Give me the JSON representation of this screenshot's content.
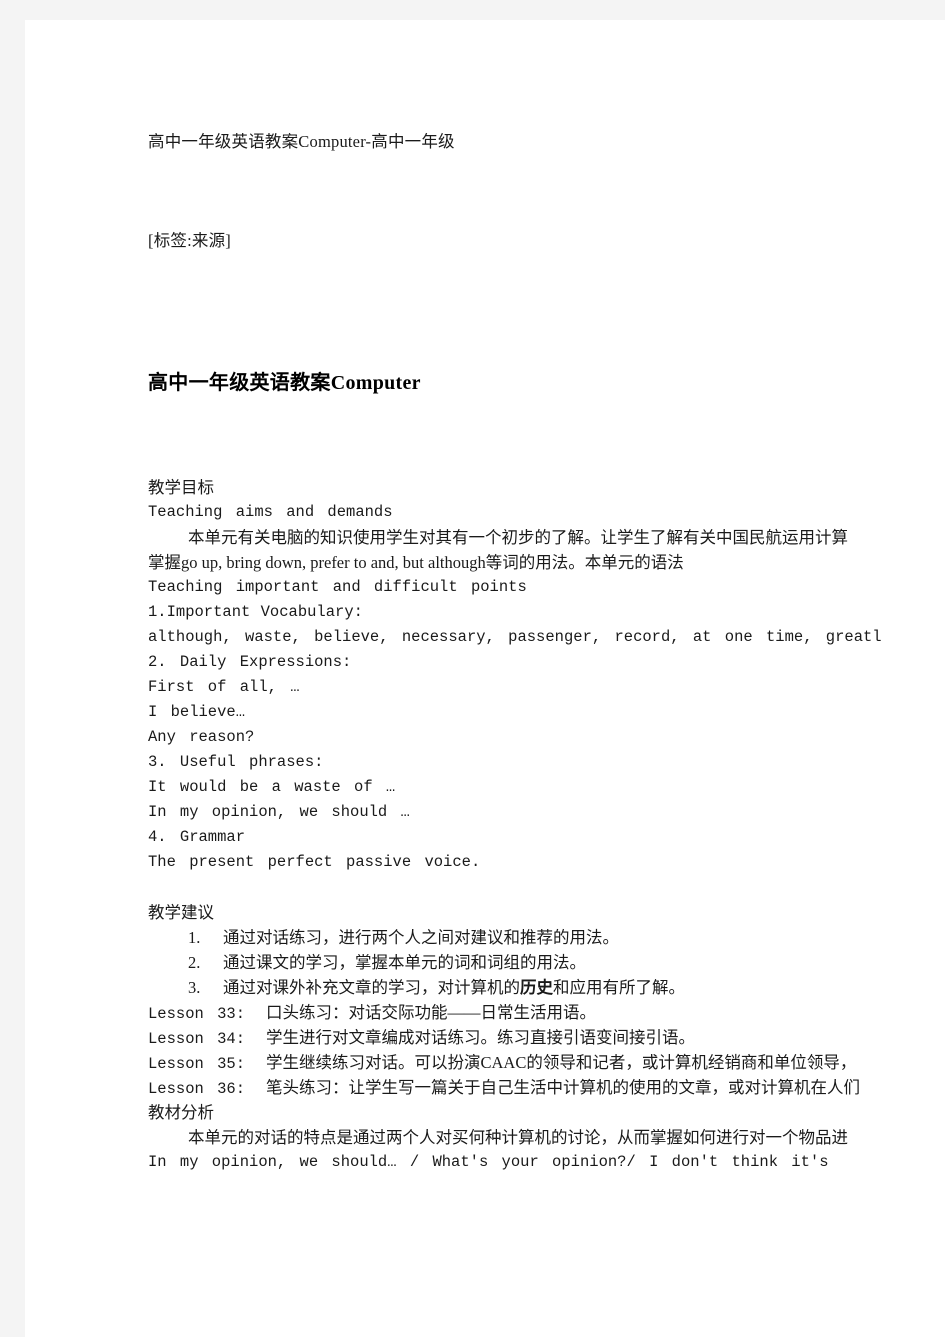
{
  "document": {
    "header_title": "高中一年级英语教案Computer-高中一年级",
    "header_tag": "[标签:来源]",
    "main_title": "高中一年级英语教案Computer",
    "sections": {
      "aims": {
        "heading": "教学目标",
        "line_en_1": "Teaching  aims  and  demands",
        "para_cn": "本单元有关电脑的知识使用学生对其有一个初步的了解。让学生了解有关中国民航运用计算",
        "line_cn_en": "掌握go  up,  bring  down,  prefer  to  and,  but  although等词的用法。本单元的语法",
        "line_en_2": "Teaching  important  and  difficult  points",
        "vocab_heading": "1.Important  Vocabulary:",
        "vocab_list": "although,  waste,  believe,  necessary,  passenger,  record,  at  one  time,  greatl",
        "daily_heading": "2.  Daily  Expressions:",
        "daily_1": "First  of  all,  …",
        "daily_2": "I  believe…",
        "daily_3": "Any  reason?",
        "phrases_heading": "3.  Useful  phrases:",
        "phrase_1": "It  would  be  a  waste  of  …",
        "phrase_2": "In  my  opinion,  we  should  …",
        "grammar_heading": "4.  Grammar",
        "grammar_1": "The  present  perfect  passive  voice."
      },
      "suggestions": {
        "heading": "教学建议",
        "items": [
          {
            "num": "1.",
            "text_before": "通过对话练习，进行两个人之间对建议和推荐的用法。",
            "bold": "",
            "text_after": ""
          },
          {
            "num": "2.",
            "text_before": "通过课文的学习，掌握本单元的词和词组的用法。",
            "bold": "",
            "text_after": ""
          },
          {
            "num": "3.",
            "text_before": "通过对课外补充文章的学习，对计算机的",
            "bold": "历史",
            "text_after": "和应用有所了解。"
          }
        ],
        "lessons": [
          {
            "label": "Lesson  33:",
            "text": "口头练习：对话交际功能——日常生活用语。"
          },
          {
            "label": "Lesson  34:",
            "text": "学生进行对文章编成对话练习。练习直接引语变间接引语。"
          },
          {
            "label": "Lesson  35:",
            "text": "学生继续练习对话。可以扮演CAAC的领导和记者，或计算机经销商和单位领导，"
          },
          {
            "label": "Lesson  36:",
            "text": "笔头练习：让学生写一篇关于自己生活中计算机的使用的文章，或对计算机在人们"
          }
        ]
      },
      "analysis": {
        "heading": "教材分析",
        "para_cn": "本单元的对话的特点是通过两个人对买何种计算机的讨论，从而掌握如何进行对一个物品进",
        "line_en": "In  my  opinion,  we  should…  /  What's  your  opinion?/  I  don't  think  it's"
      }
    }
  },
  "colors": {
    "page_background": "#ffffff",
    "canvas_background": "#f4f4f4",
    "text": "#1a1a1a"
  }
}
